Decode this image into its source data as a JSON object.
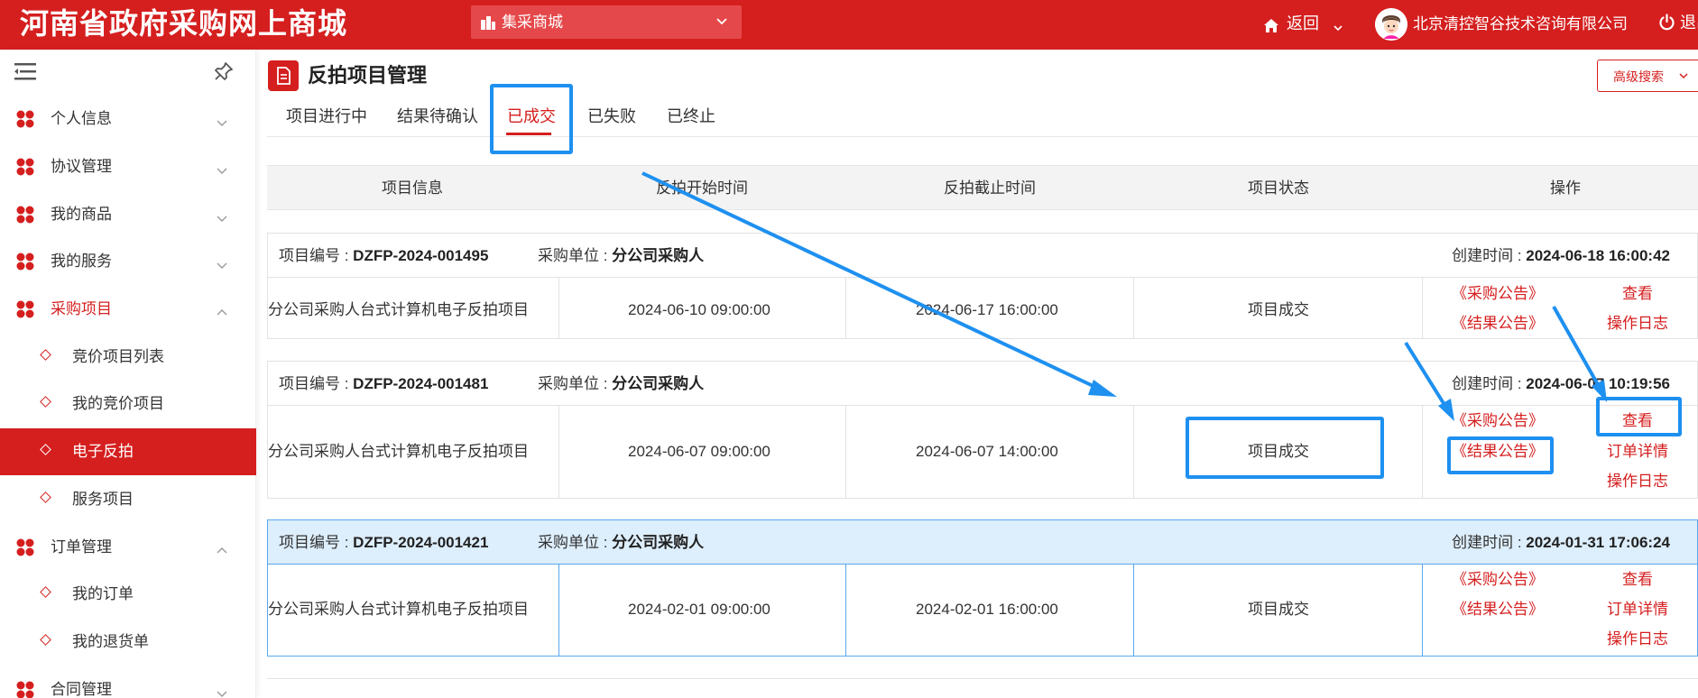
{
  "header": {
    "site_title": "河南省政府采购网上商城",
    "mall_select": "集采商城",
    "back": "返回",
    "company": "北京清控智谷技术咨询有限公司",
    "logout": "退出"
  },
  "sidebar": {
    "items": [
      {
        "label": "个人信息",
        "expanded": false
      },
      {
        "label": "协议管理",
        "expanded": false
      },
      {
        "label": "我的商品",
        "expanded": false
      },
      {
        "label": "我的服务",
        "expanded": false
      },
      {
        "label": "采购项目",
        "expanded": true
      },
      {
        "label": "订单管理",
        "expanded": true
      },
      {
        "label": "合同管理",
        "expanded": false
      }
    ],
    "procurement_sub": [
      "竞价项目列表",
      "我的竞价项目",
      "电子反拍",
      "服务项目"
    ],
    "order_sub": [
      "我的订单",
      "我的退货单"
    ],
    "active_sub": "电子反拍"
  },
  "main": {
    "title": "反拍项目管理",
    "advanced_search": "高级搜索",
    "tabs": [
      "项目进行中",
      "结果待确认",
      "已成交",
      "已失败",
      "已终止"
    ],
    "active_tab": "已成交",
    "columns": [
      "项目信息",
      "反拍开始时间",
      "反拍截止时间",
      "项目状态",
      "操作"
    ],
    "labels": {
      "project_no": "项目编号 : ",
      "buyer": "采购单位 : ",
      "created": "创建时间 : "
    },
    "projects": [
      {
        "no": "DZFP-2024-001495",
        "buyer": "分公司采购人",
        "created": "2024-06-18 16:00:42",
        "name": "分公司采购人台式计算机电子反拍项目",
        "start": "2024-06-10 09:00:00",
        "end": "2024-06-17 16:00:00",
        "status": "项目成交",
        "notices": [
          "《采购公告》",
          "《结果公告》"
        ],
        "actions": [
          "查看",
          "操作日志"
        ]
      },
      {
        "no": "DZFP-2024-001481",
        "buyer": "分公司采购人",
        "created": "2024-06-07 10:19:56",
        "name": "分公司采购人台式计算机电子反拍项目",
        "start": "2024-06-07 09:00:00",
        "end": "2024-06-07 14:00:00",
        "status": "项目成交",
        "notices": [
          "《采购公告》",
          "《结果公告》"
        ],
        "actions": [
          "查看",
          "订单详情",
          "操作日志"
        ]
      },
      {
        "no": "DZFP-2024-001421",
        "buyer": "分公司采购人",
        "created": "2024-01-31 17:06:24",
        "name": "分公司采购人台式计算机电子反拍项目",
        "start": "2024-02-01 09:00:00",
        "end": "2024-02-01 16:00:00",
        "status": "项目成交",
        "notices": [
          "《采购公告》",
          "《结果公告》"
        ],
        "actions": [
          "查看",
          "订单详情",
          "操作日志"
        ]
      }
    ]
  },
  "colors": {
    "brand_red": "#d51f1f",
    "annotation_blue": "#1e90f0",
    "highlight_row": "#ddeefc"
  }
}
